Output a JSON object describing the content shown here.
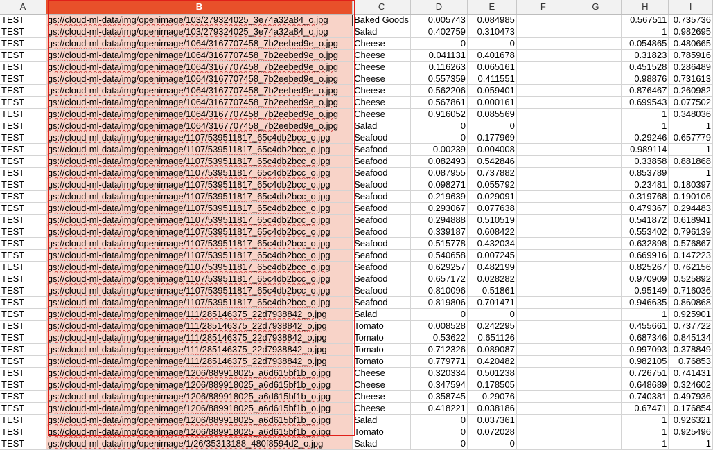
{
  "columns": [
    "A",
    "B",
    "C",
    "D",
    "E",
    "F",
    "G",
    "H",
    "I"
  ],
  "selected_column": "B",
  "rows": [
    [
      "TEST",
      "gs://cloud-ml-data/img/openimage/103/279324025_3e74a32a84_o.jpg",
      "Baked Goods",
      "0.005743",
      "0.084985",
      "",
      "",
      "0.567511",
      "0.735736"
    ],
    [
      "TEST",
      "gs://cloud-ml-data/img/openimage/103/279324025_3e74a32a84_o.jpg",
      "Salad",
      "0.402759",
      "0.310473",
      "",
      "",
      "1",
      "0.982695"
    ],
    [
      "TEST",
      "gs://cloud-ml-data/img/openimage/1064/3167707458_7b2eebed9e_o.jpg",
      "Cheese",
      "0",
      "0",
      "",
      "",
      "0.054865",
      "0.480665"
    ],
    [
      "TEST",
      "gs://cloud-ml-data/img/openimage/1064/3167707458_7b2eebed9e_o.jpg",
      "Cheese",
      "0.041131",
      "0.401678",
      "",
      "",
      "0.31823",
      "0.785916"
    ],
    [
      "TEST",
      "gs://cloud-ml-data/img/openimage/1064/3167707458_7b2eebed9e_o.jpg",
      "Cheese",
      "0.116263",
      "0.065161",
      "",
      "",
      "0.451528",
      "0.286489"
    ],
    [
      "TEST",
      "gs://cloud-ml-data/img/openimage/1064/3167707458_7b2eebed9e_o.jpg",
      "Cheese",
      "0.557359",
      "0.411551",
      "",
      "",
      "0.98876",
      "0.731613"
    ],
    [
      "TEST",
      "gs://cloud-ml-data/img/openimage/1064/3167707458_7b2eebed9e_o.jpg",
      "Cheese",
      "0.562206",
      "0.059401",
      "",
      "",
      "0.876467",
      "0.260982"
    ],
    [
      "TEST",
      "gs://cloud-ml-data/img/openimage/1064/3167707458_7b2eebed9e_o.jpg",
      "Cheese",
      "0.567861",
      "0.000161",
      "",
      "",
      "0.699543",
      "0.077502"
    ],
    [
      "TEST",
      "gs://cloud-ml-data/img/openimage/1064/3167707458_7b2eebed9e_o.jpg",
      "Cheese",
      "0.916052",
      "0.085569",
      "",
      "",
      "1",
      "0.348036"
    ],
    [
      "TEST",
      "gs://cloud-ml-data/img/openimage/1064/3167707458_7b2eebed9e_o.jpg",
      "Salad",
      "0",
      "0",
      "",
      "",
      "1",
      "1"
    ],
    [
      "TEST",
      "gs://cloud-ml-data/img/openimage/1107/539511817_65c4db2bcc_o.jpg",
      "Seafood",
      "0",
      "0.177969",
      "",
      "",
      "0.29246",
      "0.657779"
    ],
    [
      "TEST",
      "gs://cloud-ml-data/img/openimage/1107/539511817_65c4db2bcc_o.jpg",
      "Seafood",
      "0.00239",
      "0.004008",
      "",
      "",
      "0.989114",
      "1"
    ],
    [
      "TEST",
      "gs://cloud-ml-data/img/openimage/1107/539511817_65c4db2bcc_o.jpg",
      "Seafood",
      "0.082493",
      "0.542846",
      "",
      "",
      "0.33858",
      "0.881868"
    ],
    [
      "TEST",
      "gs://cloud-ml-data/img/openimage/1107/539511817_65c4db2bcc_o.jpg",
      "Seafood",
      "0.087955",
      "0.737882",
      "",
      "",
      "0.853789",
      "1"
    ],
    [
      "TEST",
      "gs://cloud-ml-data/img/openimage/1107/539511817_65c4db2bcc_o.jpg",
      "Seafood",
      "0.098271",
      "0.055792",
      "",
      "",
      "0.23481",
      "0.180397"
    ],
    [
      "TEST",
      "gs://cloud-ml-data/img/openimage/1107/539511817_65c4db2bcc_o.jpg",
      "Seafood",
      "0.219639",
      "0.029091",
      "",
      "",
      "0.319768",
      "0.190106"
    ],
    [
      "TEST",
      "gs://cloud-ml-data/img/openimage/1107/539511817_65c4db2bcc_o.jpg",
      "Seafood",
      "0.293067",
      "0.077638",
      "",
      "",
      "0.479367",
      "0.294483"
    ],
    [
      "TEST",
      "gs://cloud-ml-data/img/openimage/1107/539511817_65c4db2bcc_o.jpg",
      "Seafood",
      "0.294888",
      "0.510519",
      "",
      "",
      "0.541872",
      "0.618941"
    ],
    [
      "TEST",
      "gs://cloud-ml-data/img/openimage/1107/539511817_65c4db2bcc_o.jpg",
      "Seafood",
      "0.339187",
      "0.608422",
      "",
      "",
      "0.553402",
      "0.796139"
    ],
    [
      "TEST",
      "gs://cloud-ml-data/img/openimage/1107/539511817_65c4db2bcc_o.jpg",
      "Seafood",
      "0.515778",
      "0.432034",
      "",
      "",
      "0.632898",
      "0.576867"
    ],
    [
      "TEST",
      "gs://cloud-ml-data/img/openimage/1107/539511817_65c4db2bcc_o.jpg",
      "Seafood",
      "0.540658",
      "0.007245",
      "",
      "",
      "0.669916",
      "0.147223"
    ],
    [
      "TEST",
      "gs://cloud-ml-data/img/openimage/1107/539511817_65c4db2bcc_o.jpg",
      "Seafood",
      "0.629257",
      "0.482199",
      "",
      "",
      "0.825267",
      "0.762156"
    ],
    [
      "TEST",
      "gs://cloud-ml-data/img/openimage/1107/539511817_65c4db2bcc_o.jpg",
      "Seafood",
      "0.657172",
      "0.028282",
      "",
      "",
      "0.970909",
      "0.525892"
    ],
    [
      "TEST",
      "gs://cloud-ml-data/img/openimage/1107/539511817_65c4db2bcc_o.jpg",
      "Seafood",
      "0.810096",
      "0.51861",
      "",
      "",
      "0.95149",
      "0.716036"
    ],
    [
      "TEST",
      "gs://cloud-ml-data/img/openimage/1107/539511817_65c4db2bcc_o.jpg",
      "Seafood",
      "0.819806",
      "0.701471",
      "",
      "",
      "0.946635",
      "0.860868"
    ],
    [
      "TEST",
      "gs://cloud-ml-data/img/openimage/111/285146375_22d7938842_o.jpg",
      "Salad",
      "0",
      "0",
      "",
      "",
      "1",
      "0.925901"
    ],
    [
      "TEST",
      "gs://cloud-ml-data/img/openimage/111/285146375_22d7938842_o.jpg",
      "Tomato",
      "0.008528",
      "0.242295",
      "",
      "",
      "0.455661",
      "0.737722"
    ],
    [
      "TEST",
      "gs://cloud-ml-data/img/openimage/111/285146375_22d7938842_o.jpg",
      "Tomato",
      "0.53622",
      "0.651126",
      "",
      "",
      "0.687346",
      "0.845134"
    ],
    [
      "TEST",
      "gs://cloud-ml-data/img/openimage/111/285146375_22d7938842_o.jpg",
      "Tomato",
      "0.712326",
      "0.089087",
      "",
      "",
      "0.997093",
      "0.378849"
    ],
    [
      "TEST",
      "gs://cloud-ml-data/img/openimage/111/285146375_22d7938842_o.jpg",
      "Tomato",
      "0.779771",
      "0.420482",
      "",
      "",
      "0.982105",
      "0.76853"
    ],
    [
      "TEST",
      "gs://cloud-ml-data/img/openimage/1206/889918025_a6d615bf1b_o.jpg",
      "Cheese",
      "0.320334",
      "0.501238",
      "",
      "",
      "0.726751",
      "0.741431"
    ],
    [
      "TEST",
      "gs://cloud-ml-data/img/openimage/1206/889918025_a6d615bf1b_o.jpg",
      "Cheese",
      "0.347594",
      "0.178505",
      "",
      "",
      "0.648689",
      "0.324602"
    ],
    [
      "TEST",
      "gs://cloud-ml-data/img/openimage/1206/889918025_a6d615bf1b_o.jpg",
      "Cheese",
      "0.358745",
      "0.29076",
      "",
      "",
      "0.740381",
      "0.497936"
    ],
    [
      "TEST",
      "gs://cloud-ml-data/img/openimage/1206/889918025_a6d615bf1b_o.jpg",
      "Cheese",
      "0.418221",
      "0.038186",
      "",
      "",
      "0.67471",
      "0.176854"
    ],
    [
      "TEST",
      "gs://cloud-ml-data/img/openimage/1206/889918025_a6d615bf1b_o.jpg",
      "Salad",
      "0",
      "0.037361",
      "",
      "",
      "1",
      "0.926321"
    ],
    [
      "TEST",
      "gs://cloud-ml-data/img/openimage/1206/889918025_a6d615bf1b_o.jpg",
      "Tomato",
      "0",
      "0.072028",
      "",
      "",
      "1",
      "0.925496"
    ],
    [
      "TEST",
      "gs://cloud-ml-data/img/openimage/1/26/35313188_480f8594d2_o.jpg",
      "Salad",
      "0",
      "0",
      "",
      "",
      "1",
      "1"
    ]
  ],
  "colors": {
    "selection_border": "#e0201a",
    "selection_header": "#e8502a",
    "selection_fill": "#f8d3c8"
  }
}
